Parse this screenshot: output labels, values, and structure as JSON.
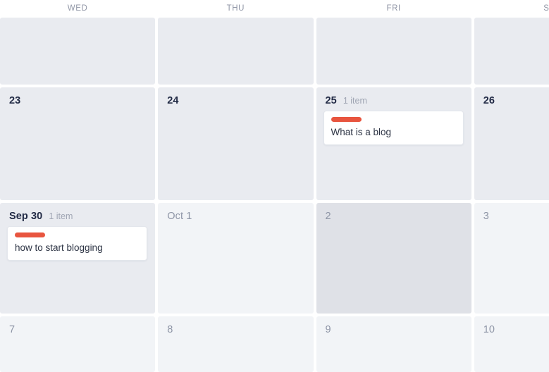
{
  "calendar": {
    "weekday_headers": [
      "WED",
      "THU",
      "FRI",
      "SAT"
    ],
    "accent_color": "#e8553f",
    "colors": {
      "cell_bg_current": "#e9ebf0",
      "cell_bg_other": "#f2f4f7",
      "cell_bg_selected": "#dfe1e7",
      "date_text": "#212a45",
      "date_text_muted": "#8e95a6",
      "item_count_text": "#a0a6b4",
      "card_bg": "#ffffff",
      "page_bg": "#ffffff"
    },
    "weeks": [
      {
        "days": [
          {
            "label": "",
            "count_label": "",
            "muted": false,
            "selected": false,
            "events": []
          },
          {
            "label": "",
            "count_label": "",
            "muted": false,
            "selected": false,
            "events": []
          },
          {
            "label": "",
            "count_label": "",
            "muted": false,
            "selected": false,
            "events": []
          },
          {
            "label": "",
            "count_label": "",
            "muted": false,
            "selected": false,
            "events": []
          }
        ]
      },
      {
        "days": [
          {
            "label": "23",
            "count_label": "",
            "muted": false,
            "selected": false,
            "events": []
          },
          {
            "label": "24",
            "count_label": "",
            "muted": false,
            "selected": false,
            "events": []
          },
          {
            "label": "25",
            "count_label": "1 item",
            "muted": false,
            "selected": false,
            "events": [
              {
                "title": "What is a blog",
                "color": "#e8553f"
              }
            ]
          },
          {
            "label": "26",
            "count_label": "",
            "muted": false,
            "selected": false,
            "events": []
          }
        ]
      },
      {
        "days": [
          {
            "label": "Sep 30",
            "count_label": "1 item",
            "muted": false,
            "selected": false,
            "events": [
              {
                "title": "how to start blogging",
                "color": "#e8553f"
              }
            ]
          },
          {
            "label": "Oct 1",
            "count_label": "",
            "muted": true,
            "selected": false,
            "events": []
          },
          {
            "label": "2",
            "count_label": "",
            "muted": true,
            "selected": true,
            "events": []
          },
          {
            "label": "3",
            "count_label": "",
            "muted": true,
            "selected": false,
            "events": []
          }
        ]
      },
      {
        "days": [
          {
            "label": "7",
            "count_label": "",
            "muted": true,
            "selected": false,
            "events": []
          },
          {
            "label": "8",
            "count_label": "",
            "muted": true,
            "selected": false,
            "events": []
          },
          {
            "label": "9",
            "count_label": "",
            "muted": true,
            "selected": false,
            "events": []
          },
          {
            "label": "10",
            "count_label": "",
            "muted": true,
            "selected": false,
            "events": []
          }
        ]
      }
    ]
  }
}
